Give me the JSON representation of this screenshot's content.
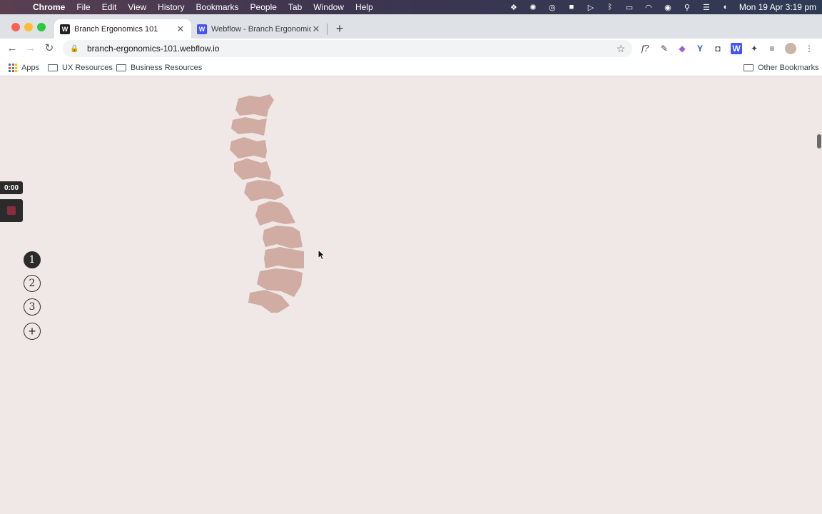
{
  "menubar": {
    "app_name": "Chrome",
    "items": [
      "File",
      "Edit",
      "View",
      "History",
      "Bookmarks",
      "People",
      "Tab",
      "Window",
      "Help"
    ],
    "clock": "Mon 19 Apr  3:19 pm"
  },
  "tabs": [
    {
      "title": "Branch Ergonomics 101",
      "favicon": "W"
    },
    {
      "title": "Webflow - Branch Ergonomics",
      "favicon": "W"
    }
  ],
  "toolbar": {
    "url": "branch-ergonomics-101.webflow.io"
  },
  "bookmarks": {
    "apps": "Apps",
    "items": [
      "UX Resources",
      "Business Resources"
    ],
    "other": "Other Bookmarks"
  },
  "page": {
    "timer": "0:00",
    "steps": [
      "1",
      "2",
      "3"
    ],
    "add_step_icon": "plus-circle-icon",
    "spine_color": "#d0aca2",
    "background": "#f0e8e6"
  }
}
